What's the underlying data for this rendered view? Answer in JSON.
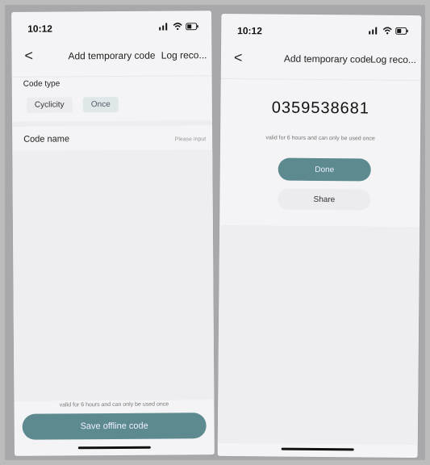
{
  "left": {
    "status": {
      "time": "10:12"
    },
    "nav": {
      "back": "<",
      "title": "Add temporary code",
      "right": "Log reco..."
    },
    "code_type": {
      "label": "Code type",
      "options": [
        "Cyclicity",
        "Once"
      ]
    },
    "code_name": {
      "label": "Code name",
      "placeholder": "Please input"
    },
    "hint": "valid for 6 hours and can only be used once",
    "save_button": "Save offline code"
  },
  "right": {
    "status": {
      "time": "10:12"
    },
    "nav": {
      "back": "<",
      "title": "Add temporary code",
      "right": "Log reco..."
    },
    "code": "0359538681",
    "hint": "valid for 6 hours and can only be used once",
    "done_button": "Done",
    "share_button": "Share"
  },
  "colors": {
    "primary": "#5c8a8f",
    "background": "#f4f4f6"
  }
}
